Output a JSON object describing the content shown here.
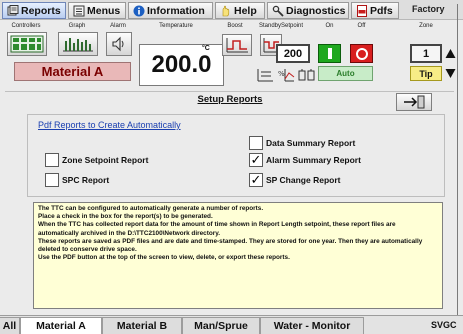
{
  "toolbar": {
    "tabs": [
      {
        "label": "Reports",
        "icon": "reports-icon",
        "active": true
      },
      {
        "label": "Menus",
        "icon": "menus-icon",
        "active": false
      },
      {
        "label": "Information",
        "icon": "information-icon",
        "active": false
      },
      {
        "label": "Help",
        "icon": "help-icon",
        "active": false
      },
      {
        "label": "Diagnostics",
        "icon": "diagnostics-icon",
        "active": false
      },
      {
        "label": "Pdfs",
        "icon": "pdf-icon",
        "active": false
      }
    ],
    "right_label": "Factory"
  },
  "controls": {
    "labels": {
      "controllers": "Controllers",
      "graph": "Graph",
      "alarm": "Alarm",
      "temperature": "Temperature",
      "boost": "Boost",
      "standby": "Standby",
      "setpoint": "Setpoint",
      "on": "On",
      "off": "Off",
      "zone": "Zone"
    },
    "material": "Material A",
    "temperature_value": "200.0",
    "temperature_unit": "°C",
    "setpoint_value": "200",
    "zone_value": "1",
    "auto_label": "Auto",
    "tip_label": "Tip"
  },
  "main": {
    "title": "Setup Reports",
    "group_title": "Pdf Reports to Create Automatically",
    "reports": [
      {
        "label": "Data Summary Report",
        "checked": false
      },
      {
        "label": "Zone Setpoint Report",
        "checked": false
      },
      {
        "label": "Alarm Summary Report",
        "checked": true
      },
      {
        "label": "SPC Report",
        "checked": false
      },
      {
        "label": "SP Change Report",
        "checked": true
      }
    ],
    "help_lines": [
      "The TTC can be configured to automatically generate a number of reports.",
      "Place a check in the box for the report(s) to be generated.",
      "When the TTC has collected report data for the amount of time shown in Report Length setpoint, these report files are automatically archived in the D:\\TTC2100\\Network directory.",
      "These reports are saved as PDF files and are date and time-stamped.  They are stored for one year.  Then they are automatically deleted to conserve drive space.",
      "Use the PDF button at the top of the screen to view, delete, or export these reports."
    ]
  },
  "bottom_tabs": [
    {
      "label": "All",
      "active": false
    },
    {
      "label": "Material A",
      "active": true
    },
    {
      "label": "Material B",
      "active": false
    },
    {
      "label": "Man/Sprue",
      "active": false
    },
    {
      "label": "Water - Monitor",
      "active": false
    }
  ],
  "bottom_right": "SVGC",
  "colors": {
    "material_bg": "#e9b8b8",
    "material_text": "#7a0000",
    "on_green": "#1fa81f",
    "off_red": "#d81f1f",
    "auto_green": "#c8ecc8",
    "tip_yellow": "#f7ec86",
    "help_bg": "#ffffd6",
    "link_blue": "#1a3fb0"
  }
}
